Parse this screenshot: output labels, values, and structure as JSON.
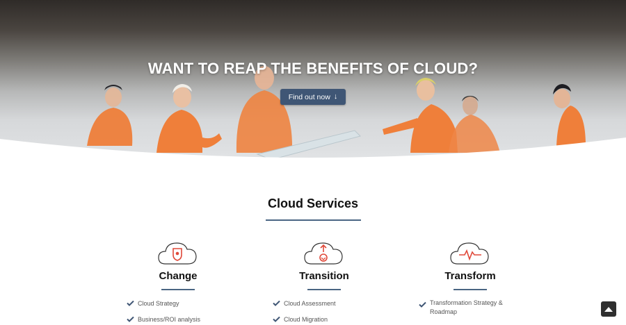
{
  "hero": {
    "title": "WANT TO REAP THE BENEFITS OF CLOUD?",
    "button_label": "Find out now",
    "button_icon": "arrow-down-icon",
    "figure_color": "#ef7f3a"
  },
  "section": {
    "title": "Cloud Services",
    "accent_color": "#4a6583"
  },
  "columns": [
    {
      "title": "Change",
      "icon": "cloud-shield-icon",
      "items": [
        "Cloud Strategy",
        "Business/ROI analysis"
      ]
    },
    {
      "title": "Transition",
      "icon": "cloud-migration-icon",
      "items": [
        "Cloud Assessment",
        "Cloud Migration"
      ]
    },
    {
      "title": "Transform",
      "icon": "cloud-pulse-icon",
      "items": [
        "Transformation Strategy & Roadmap"
      ]
    }
  ],
  "scroll_top": {
    "icon": "caret-up-icon"
  },
  "colors": {
    "check": "#3f5675",
    "icon_red": "#e0493a",
    "button_bg": "#3f5675"
  }
}
